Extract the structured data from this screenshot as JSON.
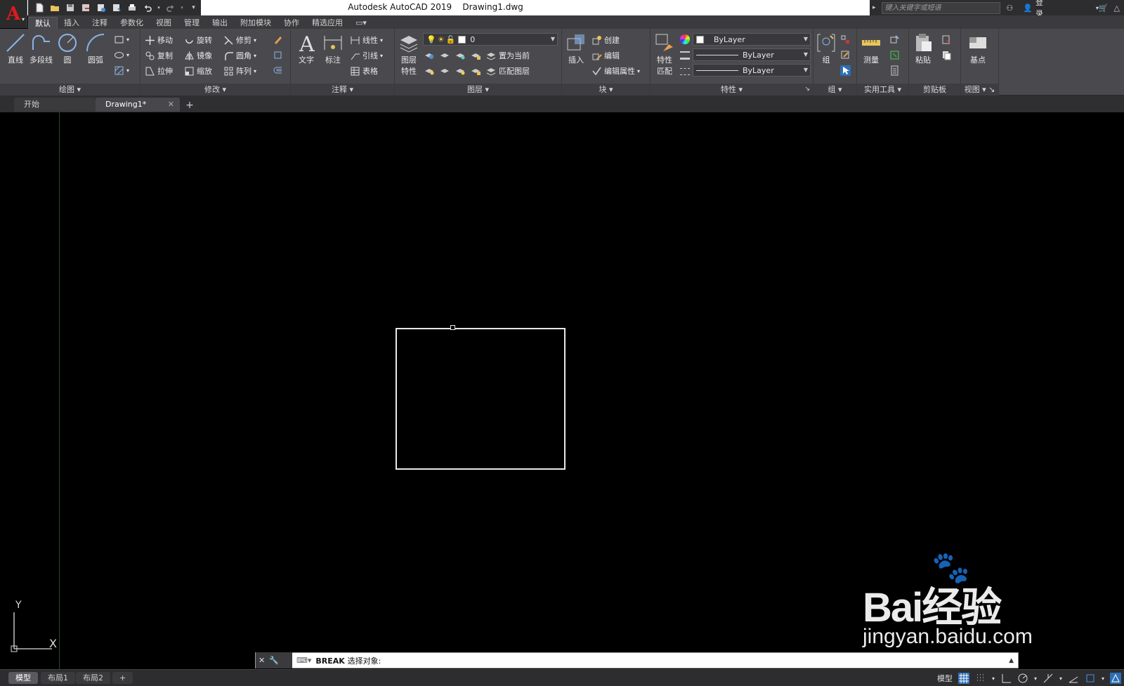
{
  "titlebar": {
    "title": "Autodesk AutoCAD 2019    Drawing1.dwg",
    "search_placeholder": "键入关键字或短语",
    "login": "登录"
  },
  "ribbon_tabs": [
    "默认",
    "插入",
    "注释",
    "参数化",
    "视图",
    "管理",
    "输出",
    "附加模块",
    "协作",
    "精选应用"
  ],
  "panels": {
    "draw": {
      "footer": "绘图",
      "line": "直线",
      "polyline": "多段线",
      "circle": "圆",
      "arc": "圆弧"
    },
    "modify": {
      "footer": "修改",
      "move": "移动",
      "rotate": "旋转",
      "trim": "修剪",
      "copy": "复制",
      "mirror": "镜像",
      "fillet": "圆角",
      "stretch": "拉伸",
      "scale": "缩放",
      "array": "阵列"
    },
    "annotation": {
      "footer": "注释",
      "text": "文字",
      "dimension": "标注",
      "linear": "线性",
      "leader": "引线",
      "table": "表格"
    },
    "layers": {
      "footer": "图层",
      "layer_props_1": "图层",
      "layer_props_2": "特性",
      "current_layer": "0",
      "set_current": "置为当前",
      "match_layer": "匹配图层"
    },
    "block": {
      "footer": "块",
      "insert": "插入",
      "create": "创建",
      "edit": "编辑",
      "edit_attributes": "编辑属性"
    },
    "properties": {
      "footer": "特性",
      "match_1": "特性",
      "match_2": "匹配",
      "color": "ByLayer",
      "lineweight": "ByLayer",
      "linetype": "ByLayer"
    },
    "groups": {
      "footer": "组",
      "group": "组"
    },
    "utilities": {
      "footer": "实用工具",
      "measure": "测量"
    },
    "clipboard": {
      "footer": "剪贴板",
      "paste": "粘贴"
    },
    "view": {
      "footer": "视图",
      "basepoint": "基点"
    }
  },
  "file_tabs": {
    "start": "开始",
    "drawing": "Drawing1*"
  },
  "ucs": {
    "y": "Y",
    "x": "X"
  },
  "watermark": {
    "brand": "Bai经验",
    "url": "jingyan.baidu.com"
  },
  "command": {
    "name": "BREAK",
    "prompt": "选择对象:"
  },
  "layout_tabs": [
    "模型",
    "布局1",
    "布局2"
  ],
  "status": {
    "model": "模型"
  },
  "colors": {
    "accent": "#e0191e",
    "canvas": "#000000",
    "ribbon": "#4a4a4e"
  }
}
